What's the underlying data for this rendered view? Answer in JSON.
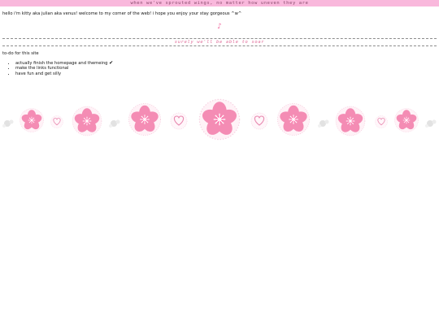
{
  "banner": {
    "text": "when we've sprouted wings, no matter how uneven they are"
  },
  "intro": {
    "greeting": "hello i'm kitty aka julian aka venus! welcome to my corner of the web! i hope you enjoy your stay gorgeous ^w^"
  },
  "icons": {
    "note": "music-note-icon",
    "check": "checkmark-icon"
  },
  "divider": {
    "text": "surely we'll be able to soar"
  },
  "todo": {
    "title": "to-do for this site",
    "items": [
      {
        "label": "actually finish the homepage and themeing",
        "mark": "✔"
      },
      {
        "label": "make the links functional"
      },
      {
        "label": "have fun and get silly"
      }
    ]
  },
  "colors": {
    "banner_bg": "#f9b8dc",
    "flower": "#f48cb4",
    "flower_center": "#ff5a9c",
    "heart": "#e88ab0",
    "accent_text": "#e06a98"
  }
}
